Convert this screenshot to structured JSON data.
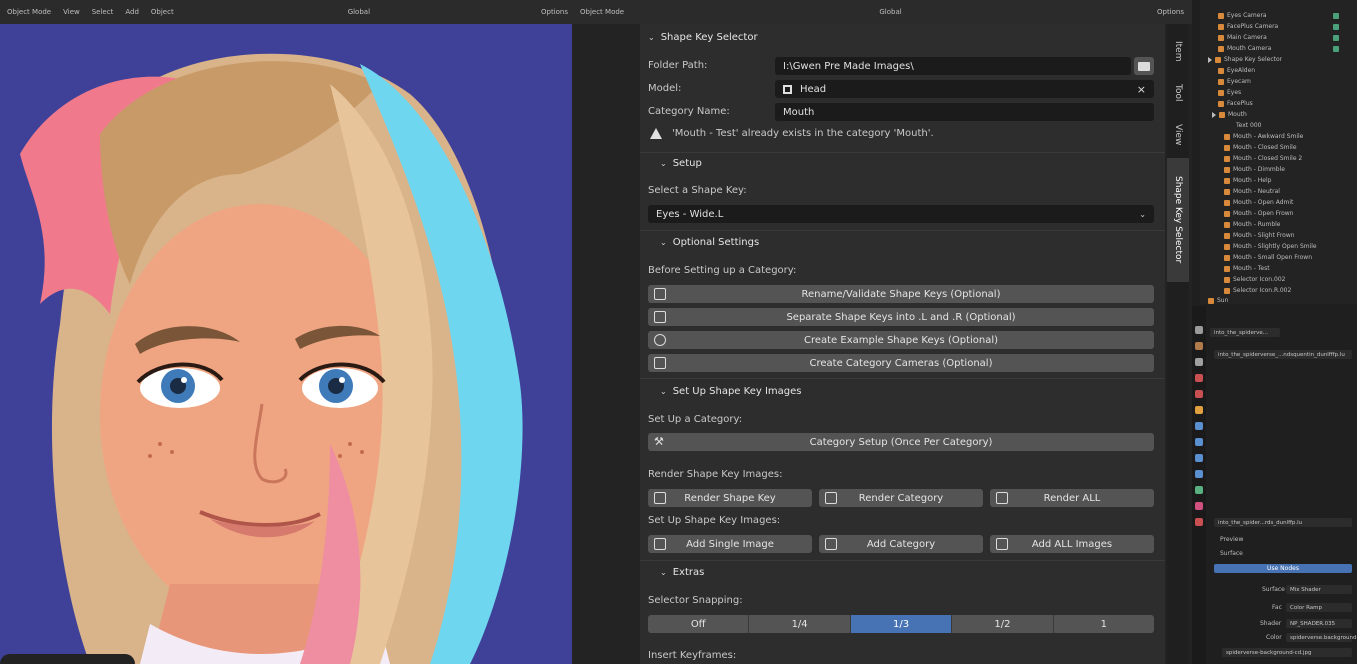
{
  "viewport": {
    "header": {
      "mode": "Object Mode",
      "menus": [
        "View",
        "Select",
        "Add",
        "Object"
      ],
      "orientation": "Global",
      "options": "Options"
    }
  },
  "editor2": {
    "header": {
      "mode": "Object Mode",
      "orientation": "Global",
      "options": "Options"
    }
  },
  "panel": {
    "title": "Shape Key Selector",
    "folder_path_label": "Folder Path:",
    "folder_path_value": "I:\\Gwen Pre Made Images\\",
    "model_label": "Model:",
    "model_value": "Head",
    "category_name_label": "Category Name:",
    "category_name_value": "Mouth",
    "warning": "'Mouth - Test' already exists in the category 'Mouth'.",
    "setup": {
      "title": "Setup",
      "select_shape_key_label": "Select a Shape Key:",
      "select_shape_key_value": "Eyes - Wide.L"
    },
    "optional": {
      "title": "Optional Settings",
      "before_label": "Before Setting up a Category:",
      "buttons": [
        "Rename/Validate Shape Keys (Optional)",
        "Separate Shape Keys into .L and .R (Optional)",
        "Create Example Shape Keys (Optional)",
        "Create Category Cameras (Optional)"
      ]
    },
    "images": {
      "title": "Set Up Shape Key Images",
      "setup_category_label": "Set Up a Category:",
      "category_setup_button": "Category Setup (Once Per Category)",
      "render_label": "Render Shape Key Images:",
      "render_buttons": [
        "Render Shape Key",
        "Render Category",
        "Render ALL"
      ],
      "setup_images_label": "Set Up Shape Key Images:",
      "add_buttons": [
        "Add Single Image",
        "Add Category",
        "Add ALL Images"
      ]
    },
    "extras": {
      "title": "Extras",
      "snapping_label": "Selector Snapping:",
      "snapping_options": [
        "Off",
        "1/4",
        "1/3",
        "1/2",
        "1"
      ],
      "snapping_selected": "1/3",
      "insert_keyframes_label": "Insert Keyframes:"
    }
  },
  "sidetabs": [
    "Item",
    "Tool",
    "View",
    "Shape Key Selector"
  ],
  "outliner": {
    "rows": [
      "Eyes Camera",
      "FacePlus Camera",
      "Main Camera",
      "Mouth Camera",
      "Shape Key Selector",
      "EyeAlden",
      "Eyecam",
      "Eyes",
      "FacePlus",
      "Mouth",
      "Text 000",
      "Mouth - Awkward Smile",
      "Mouth - Closed Smile",
      "Mouth - Closed Smile 2",
      "Mouth - Dimmble",
      "Mouth - Help",
      "Mouth - Neutral",
      "Mouth - Open Admit",
      "Mouth - Open Frown",
      "Mouth - Rumble",
      "Mouth - Slight Frown",
      "Mouth - Slightly Open Smile",
      "Mouth - Small Open Frown",
      "Mouth - Test",
      "Selector Icon.002",
      "Selector Icon.R.002",
      "Sun"
    ]
  },
  "properties": {
    "path1": "into_the_spiderve...",
    "path2": "into_the_spiderverse_...ndsquentin_dunlfffp.lu",
    "path3": "into_the_spider...rds_dunlffp.lu",
    "preview": "Preview",
    "surface_header": "Surface",
    "use_nodes": "Use Nodes",
    "surface_label": "Surface",
    "surface_value": "Mix Shader",
    "fac_label": "Fac",
    "fac_value": "Color Ramp",
    "shader_label": "Shader",
    "shader_value": "NP_SHADER.035",
    "color_label": "Color",
    "color_value": "spiderverse.background",
    "file_value": "spiderverse-background-cd.jpg"
  }
}
